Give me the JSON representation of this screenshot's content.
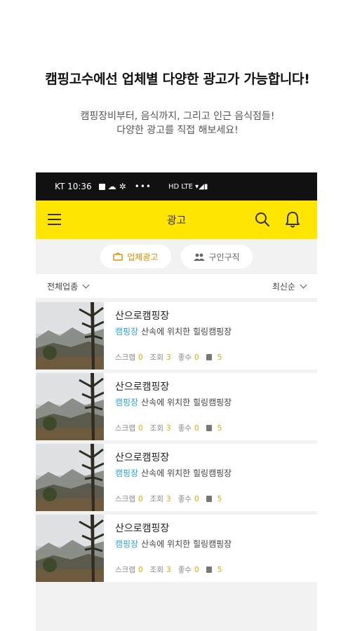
{
  "headline": "캠핑고수에선 업체별 다양한 광고가 가능합니다!",
  "subline": [
    "캠핑장비부터, 음식까지, 그리고 인근 음식점들!",
    "다양한 광고를 직접 해보세요!"
  ],
  "statusbar": {
    "carrier_time": "KT 10:36",
    "dots": "•••",
    "signal": "HD LTE ▾◢▮"
  },
  "appbar": {
    "title": "광고"
  },
  "tabs": [
    {
      "label": "업체광고",
      "active": true
    },
    {
      "label": "구인구직",
      "active": false
    }
  ],
  "filters": {
    "category": "전체업종",
    "sort": "최신순"
  },
  "listings": [
    {
      "title": "산으로캠핑장",
      "category": "캠핑장",
      "description": "산속에 위치한 힐링캠핑장",
      "scrap_label": "스크랩",
      "scrap": "0",
      "views_label": "조회",
      "views": "3",
      "likes_label": "좋수",
      "likes": "0",
      "docs": "5"
    },
    {
      "title": "산으로캠핑장",
      "category": "캠핑장",
      "description": "산속에 위치한 힐링캠핑장",
      "scrap_label": "스크랩",
      "scrap": "0",
      "views_label": "조회",
      "views": "3",
      "likes_label": "좋수",
      "likes": "0",
      "docs": "5"
    },
    {
      "title": "산으로캠핑장",
      "category": "캠핑장",
      "description": "산속에 위치한 힐링캠핑장",
      "scrap_label": "스크랩",
      "scrap": "0",
      "views_label": "조회",
      "views": "3",
      "likes_label": "좋수",
      "likes": "0",
      "docs": "5"
    },
    {
      "title": "산으로캠핑장",
      "category": "캠핑장",
      "description": "산속에 위치한 힐링캠핑장",
      "scrap_label": "스크랩",
      "scrap": "0",
      "views_label": "조회",
      "views": "3",
      "likes_label": "좋수",
      "likes": "0",
      "docs": "5"
    }
  ],
  "colors": {
    "appbar": "#ffe500",
    "accent": "#e0a800",
    "category": "#2ea3d8"
  }
}
